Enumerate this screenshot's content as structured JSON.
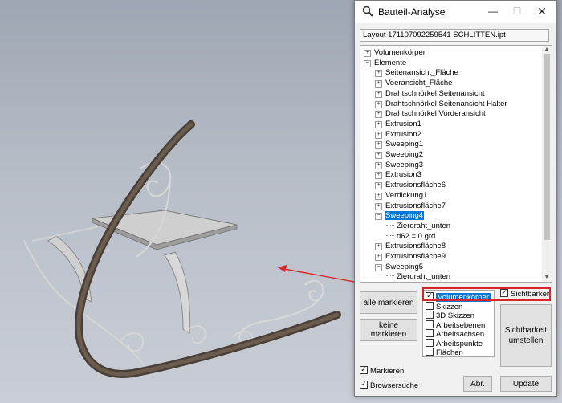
{
  "window": {
    "title": "Bauteil-Analyse",
    "minimize_glyph": "—",
    "maximize_glyph": "☐",
    "close_glyph": "✕"
  },
  "file_field": {
    "value": "Layout 171107092259541 SCHLITTEN.ipt"
  },
  "tree": {
    "items": [
      {
        "label": "Volumenkörper",
        "level": 0,
        "toggle": "+"
      },
      {
        "label": "Elemente",
        "level": 0,
        "toggle": "−"
      },
      {
        "label": "Seitenansicht_Fläche",
        "level": 1,
        "toggle": "+"
      },
      {
        "label": "Voeransicht_Fläche",
        "level": 1,
        "toggle": "+"
      },
      {
        "label": "Drahtschnörkel Seitenansicht",
        "level": 1,
        "toggle": "+"
      },
      {
        "label": "Drahtschnörkel Seitenansicht Halter",
        "level": 1,
        "toggle": "+"
      },
      {
        "label": "Drahtschnörkel Vorderansicht",
        "level": 1,
        "toggle": "+"
      },
      {
        "label": "Extrusion1",
        "level": 1,
        "toggle": "+"
      },
      {
        "label": "Extrusion2",
        "level": 1,
        "toggle": "+"
      },
      {
        "label": "Sweeping1",
        "level": 1,
        "toggle": "+"
      },
      {
        "label": "Sweeping2",
        "level": 1,
        "toggle": "+"
      },
      {
        "label": "Sweeping3",
        "level": 1,
        "toggle": "+"
      },
      {
        "label": "Extrusion3",
        "level": 1,
        "toggle": "+"
      },
      {
        "label": "Extrusionsfläche6",
        "level": 1,
        "toggle": "+"
      },
      {
        "label": "Verdickung1",
        "level": 1,
        "toggle": "+"
      },
      {
        "label": "Extrusionsfläche7",
        "level": 1,
        "toggle": "+"
      },
      {
        "label": "Sweeping4",
        "level": 1,
        "toggle": "−",
        "selected": true
      },
      {
        "label": "Zierdraht_unten",
        "level": 2,
        "toggle": ""
      },
      {
        "label": "d62 = 0 grd",
        "level": 2,
        "toggle": ""
      },
      {
        "label": "Extrusionsfläche8",
        "level": 1,
        "toggle": "+"
      },
      {
        "label": "Extrusionsfläche9",
        "level": 1,
        "toggle": "+"
      },
      {
        "label": "Sweeping5",
        "level": 1,
        "toggle": "−"
      },
      {
        "label": "Zierdraht_unten",
        "level": 2,
        "toggle": ""
      }
    ]
  },
  "buttons": {
    "mark_all": "alle markieren",
    "mark_none": "keine markieren",
    "toggle_visibility": "Sichtbarkeit umstellen",
    "cancel": "Abr.",
    "update": "Update"
  },
  "checklist": {
    "items": [
      {
        "label": "Volumenkörper",
        "checked": true,
        "selected": true
      },
      {
        "label": "Skizzen",
        "checked": false
      },
      {
        "label": "3D Skizzen",
        "checked": false
      },
      {
        "label": "Arbeitsebenen",
        "checked": false
      },
      {
        "label": "Arbeitsachsen",
        "checked": false
      },
      {
        "label": "Arbeitspunkte",
        "checked": false
      },
      {
        "label": "Flächen",
        "checked": false
      }
    ]
  },
  "visibility_checkbox": {
    "label": "Sichtbarkeit",
    "checked": true
  },
  "options": {
    "mark": {
      "label": "Markieren",
      "checked": true
    },
    "browse": {
      "label": "Browsersuche",
      "checked": true
    }
  },
  "colors": {
    "highlight_red": "#d9252a",
    "selection_blue": "#0078d7",
    "runner_brown": "#5b4d42",
    "seat_gray": "#cfcfcf"
  }
}
